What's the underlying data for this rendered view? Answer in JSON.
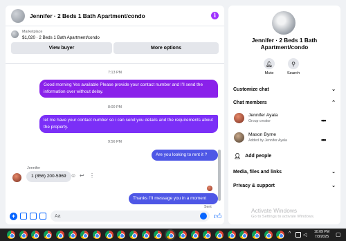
{
  "chat": {
    "title": "Jennifer · 2 Beds 1 Bath Apartment/condo",
    "info_icon": "i",
    "marketplace_label": "Marketplace",
    "listing": "$1,020 · 2 Beds 1 Bath Apartment/condo",
    "view_buyer": "View buyer",
    "more_options": "More options",
    "messages": [
      {
        "time": "7:13 PM"
      },
      {
        "text": "Good morning Yes available Please provide your contact number and I'll send the information over without delay."
      },
      {
        "time": "8:00 PM"
      },
      {
        "text": "let me have your contact number so i can send you details and the requirements about the property."
      },
      {
        "time": "9:56 PM"
      },
      {
        "text": "Are you looking to rent it ?"
      },
      {
        "sender": "Jennifer"
      },
      {
        "text": "1 (856) 200-5969"
      },
      {
        "text": "Thanks i''ll message you in a moment"
      },
      {
        "status": "Sent"
      }
    ],
    "composer_placeholder": "Aa",
    "icons": [
      "plus-icon",
      "photo-icon",
      "sticker-icon",
      "gif-icon",
      "emoji-icon",
      "thumbs-up-icon"
    ],
    "brand_color": "#8a21ea",
    "accent_color": "#0866ff"
  },
  "info": {
    "title": "Jennifer · 2 Beds 1 Bath Apartment/condo",
    "mute": "Mute",
    "search": "Search",
    "customize_chat": "Customize chat",
    "chat_members": "Chat members",
    "members": [
      {
        "name": "Jennifer Ayala",
        "role": "Group creator"
      },
      {
        "name": "Mason Byrne",
        "role": "Added by Jennifer Ayala"
      }
    ],
    "add_people": "Add people",
    "media": "Media, files and links",
    "privacy": "Privacy & support"
  },
  "watermark": {
    "title": "Activate Windows",
    "subtitle": "Go to Settings to activate Windows."
  },
  "taskbar": {
    "time": "10:09 PM",
    "date": "7/3/2025",
    "icon_count": 23
  }
}
